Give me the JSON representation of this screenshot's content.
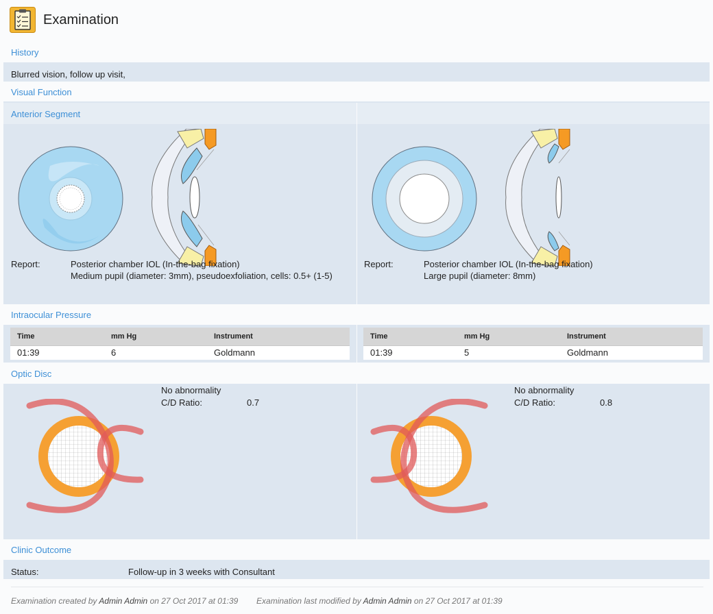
{
  "page": {
    "title": "Examination"
  },
  "history": {
    "title": "History",
    "text": "Blurred vision, follow up visit,"
  },
  "visual_function": {
    "title": "Visual Function"
  },
  "anterior_segment": {
    "title": "Anterior Segment",
    "right_eye": {
      "report_label": "Report:",
      "report_line1": "Posterior chamber IOL (In-the-bag fixation)",
      "report_line2": "Medium pupil (diameter: 3mm), pseudoexfoliation, cells: 0.5+ (1-5)"
    },
    "left_eye": {
      "report_label": "Report:",
      "report_line1": "Posterior chamber IOL (In-the-bag fixation)",
      "report_line2": "Large pupil (diameter: 8mm)"
    }
  },
  "iop": {
    "title": "Intraocular Pressure",
    "headers": {
      "time": "Time",
      "mmhg": "mm Hg",
      "instrument": "Instrument"
    },
    "right_eye": {
      "time": "01:39",
      "mmhg": "6",
      "instrument": "Goldmann"
    },
    "left_eye": {
      "time": "01:39",
      "mmhg": "5",
      "instrument": "Goldmann"
    }
  },
  "optic_disc": {
    "title": "Optic Disc",
    "right_eye": {
      "finding": "No abnormality",
      "cd_label": "C/D Ratio:",
      "cd_value": "0.7"
    },
    "left_eye": {
      "finding": "No abnormality",
      "cd_label": "C/D Ratio:",
      "cd_value": "0.8"
    }
  },
  "clinic_outcome": {
    "title": "Clinic Outcome",
    "status_label": "Status:",
    "status_value": "Follow-up in 3 weeks with Consultant"
  },
  "footer": {
    "created_prefix": "Examination created by",
    "created_by": "Admin Admin",
    "created_on": "on 27 Oct 2017 at 01:39",
    "modified_prefix": "Examination last modified by",
    "modified_by": "Admin Admin",
    "modified_on": "on 27 Oct 2017 at 01:39"
  },
  "colors": {
    "accent": "#3d8fd6",
    "band": "#dde6f0",
    "disc_orange": "#f5a033",
    "vessel_red": "#e05a5a",
    "cornea_blue": "#a8d8f2"
  }
}
